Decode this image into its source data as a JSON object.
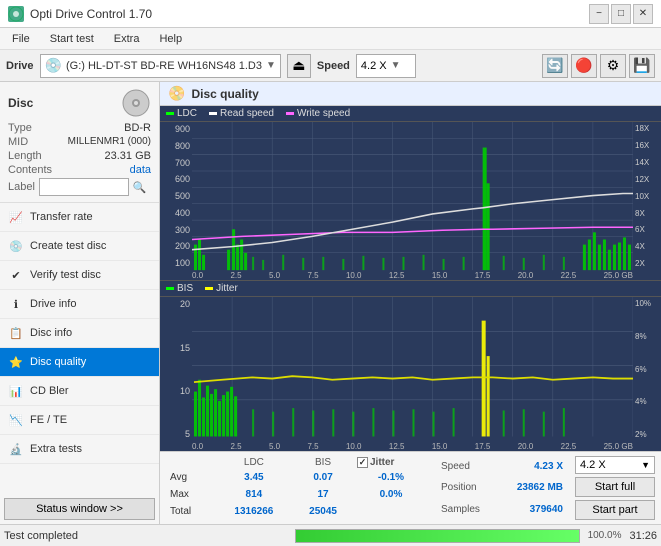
{
  "app": {
    "title": "Opti Drive Control 1.70",
    "title_icon": "ODC"
  },
  "title_buttons": {
    "minimize": "−",
    "maximize": "□",
    "close": "✕"
  },
  "menu": {
    "items": [
      "File",
      "Start test",
      "Extra",
      "Help"
    ]
  },
  "drive_bar": {
    "label": "Drive",
    "drive_name": "(G:)  HL-DT-ST BD-RE  WH16NS48 1.D3",
    "speed_label": "Speed",
    "speed_value": "4.2 X"
  },
  "disc": {
    "title": "Disc",
    "type_label": "Type",
    "type_value": "BD-R",
    "mid_label": "MID",
    "mid_value": "MILLENMR1 (000)",
    "length_label": "Length",
    "length_value": "23.31 GB",
    "contents_label": "Contents",
    "contents_value": "data",
    "label_label": "Label"
  },
  "nav": {
    "items": [
      {
        "id": "transfer-rate",
        "label": "Transfer rate",
        "icon": "📈"
      },
      {
        "id": "create-test-disc",
        "label": "Create test disc",
        "icon": "💿"
      },
      {
        "id": "verify-test-disc",
        "label": "Verify test disc",
        "icon": "✔"
      },
      {
        "id": "drive-info",
        "label": "Drive info",
        "icon": "ℹ"
      },
      {
        "id": "disc-info",
        "label": "Disc info",
        "icon": "📋"
      },
      {
        "id": "disc-quality",
        "label": "Disc quality",
        "icon": "⭐",
        "active": true
      },
      {
        "id": "cd-bler",
        "label": "CD Bler",
        "icon": "📊"
      },
      {
        "id": "fe-te",
        "label": "FE / TE",
        "icon": "📉"
      },
      {
        "id": "extra-tests",
        "label": "Extra tests",
        "icon": "🔬"
      }
    ],
    "status_button": "Status window >>"
  },
  "chart": {
    "title": "Disc quality",
    "legend_top": [
      {
        "label": "LDC",
        "color": "#00ff00"
      },
      {
        "label": "Read speed",
        "color": "#ffffff"
      },
      {
        "label": "Write speed",
        "color": "#ff00ff"
      }
    ],
    "legend_bottom": [
      {
        "label": "BIS",
        "color": "#00ff00"
      },
      {
        "label": "Jitter",
        "color": "#ffff00"
      }
    ],
    "y_axis_left_top": [
      "900",
      "800",
      "700",
      "600",
      "500",
      "400",
      "300",
      "200",
      "100",
      "0.0"
    ],
    "y_axis_right_top": [
      "18X",
      "16X",
      "14X",
      "12X",
      "10X",
      "8X",
      "6X",
      "4X",
      "2X"
    ],
    "x_axis_top": [
      "0.0",
      "2.5",
      "5.0",
      "7.5",
      "10.0",
      "12.5",
      "15.0",
      "17.5",
      "20.0",
      "22.5",
      "25.0 GB"
    ],
    "y_axis_left_bottom": [
      "20",
      "15",
      "10",
      "5"
    ],
    "y_axis_right_bottom": [
      "10%",
      "8%",
      "6%",
      "4%",
      "2%"
    ],
    "x_axis_bottom": [
      "0.0",
      "2.5",
      "5.0",
      "7.5",
      "10.0",
      "12.5",
      "15.0",
      "17.5",
      "20.0",
      "22.5",
      "25.0 GB"
    ]
  },
  "stats": {
    "headers": [
      "",
      "LDC",
      "BIS",
      "",
      "Jitter",
      "Speed",
      ""
    ],
    "avg_label": "Avg",
    "avg_ldc": "3.45",
    "avg_bis": "0.07",
    "avg_jitter": "-0.1%",
    "max_label": "Max",
    "max_ldc": "814",
    "max_bis": "17",
    "max_jitter": "0.0%",
    "total_label": "Total",
    "total_ldc": "1316266",
    "total_bis": "25045",
    "jitter_checkbox": true,
    "speed_label": "Speed",
    "speed_value": "4.23 X",
    "speed_dropdown": "4.2 X",
    "position_label": "Position",
    "position_value": "23862 MB",
    "samples_label": "Samples",
    "samples_value": "379640",
    "start_full": "Start full",
    "start_part": "Start part"
  },
  "status_bar": {
    "text": "Test completed",
    "progress": 100,
    "time": "31:26"
  },
  "colors": {
    "active_nav": "#0078d7",
    "chart_bg": "#2a3a5c",
    "ldc_color": "#00ff00",
    "bis_color": "#00ff00",
    "jitter_color": "#ffff00",
    "read_speed_color": "#ffffff",
    "write_speed_color": "#ff66ff",
    "grid_color": "#4a5a7a",
    "progress_color": "#33cc33"
  }
}
